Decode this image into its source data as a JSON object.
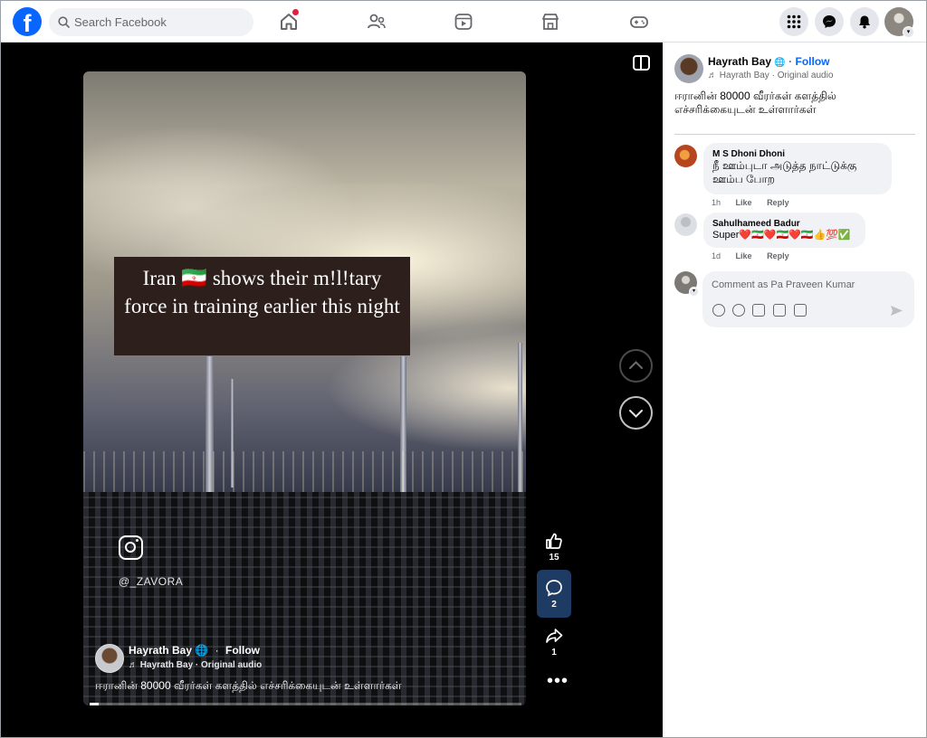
{
  "header": {
    "search_placeholder": "Search Facebook",
    "logo_letter": "f"
  },
  "video": {
    "overlay_caption": "Iran 🇮🇷 shows their m!l!tary force in training earlier this night",
    "watermark_handle": "@_ZAVORA",
    "author": "Hayrath Bay",
    "follow_label": "Follow",
    "separator": "·",
    "audio": "Hayrath Bay · Original audio",
    "caption": "ஈரானின் 80000 வீரர்கள் களத்தில் எச்சரிக்கையுடன் உள்ளார்கள்",
    "progress": 0.02,
    "likes": "15",
    "comments": "2",
    "shares": "1",
    "more_label": "•••"
  },
  "post": {
    "author": "Hayrath Bay",
    "follow_label": "Follow",
    "separator": "·",
    "audio": "Hayrath Bay · Original audio",
    "caption": "ஈரானின் 80000 வீரர்கள் களத்தில் எச்சரிக்கையுடன் உள்ளார்கள்"
  },
  "comments": [
    {
      "name": "M S Dhoni Dhoni",
      "text": "நீ ஊம்புடா அடுத்த நாட்டுக்கு ஊம்ப போற",
      "time": "1h",
      "like_label": "Like",
      "reply_label": "Reply"
    },
    {
      "name": "Sahulhameed Badur",
      "text": "Super❤️🇮🇷❤️🇮🇷❤️🇮🇷👍💯✅",
      "time": "1d",
      "like_label": "Like",
      "reply_label": "Reply"
    }
  ],
  "composer": {
    "placeholder": "Comment as Pa Praveen Kumar"
  },
  "colors": {
    "brand": "#0866ff",
    "viewer_bg": "#000000",
    "notification": "#e41e3f"
  }
}
